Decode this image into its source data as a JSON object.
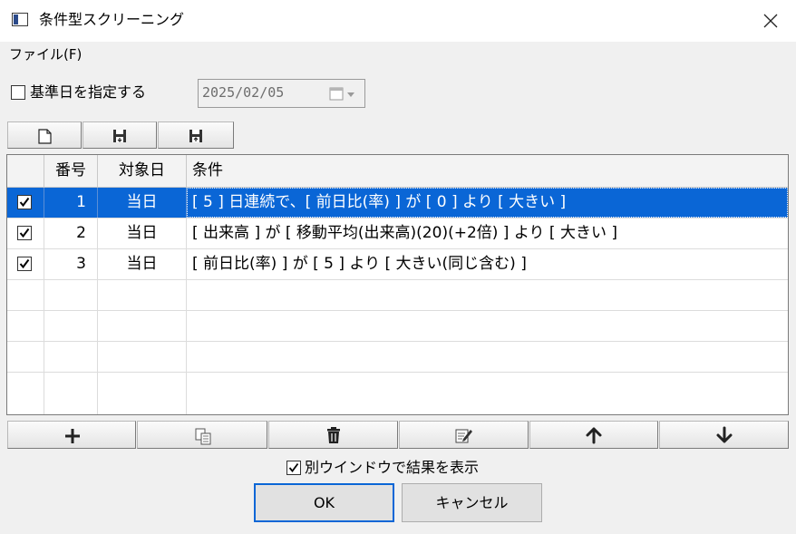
{
  "window": {
    "title": "条件型スクリーニング",
    "app_icon": "window-app-icon",
    "close_icon": "close-icon"
  },
  "menu": {
    "file": "ファイル(F)"
  },
  "basedate": {
    "checkbox_label": "基準日を指定する",
    "checked": false,
    "date_value": "2025/02/05",
    "calendar_icon": "calendar-dropdown-icon"
  },
  "file_toolbar": {
    "icons": [
      "new-file-icon",
      "open-file-icon",
      "save-file-icon"
    ]
  },
  "grid": {
    "columns": [
      "",
      "番号",
      "対象日",
      "条件"
    ],
    "rows": [
      {
        "checked": true,
        "no": "1",
        "target": "当日",
        "condition": "[ 5 ] 日連続で、[ 前日比(率) ] が [ 0 ] より [ 大きい ]",
        "selected": true
      },
      {
        "checked": true,
        "no": "2",
        "target": "当日",
        "condition": "[ 出来高 ] が [ 移動平均(出来高)(20)(+2倍) ] より [ 大きい ]",
        "selected": false
      },
      {
        "checked": true,
        "no": "3",
        "target": "当日",
        "condition": "[ 前日比(率) ] が [ 5 ] より [ 大きい(同じ含む) ]",
        "selected": false
      }
    ],
    "selection_color": "#0a66d6"
  },
  "row_toolbar": {
    "icons": [
      "add-icon",
      "copy-icon",
      "delete-icon",
      "edit-icon",
      "move-up-icon",
      "move-down-icon"
    ]
  },
  "options": {
    "separate_window_label": "別ウインドウで結果を表示",
    "separate_window_checked": true
  },
  "buttons": {
    "ok": "OK",
    "cancel": "キャンセル"
  }
}
